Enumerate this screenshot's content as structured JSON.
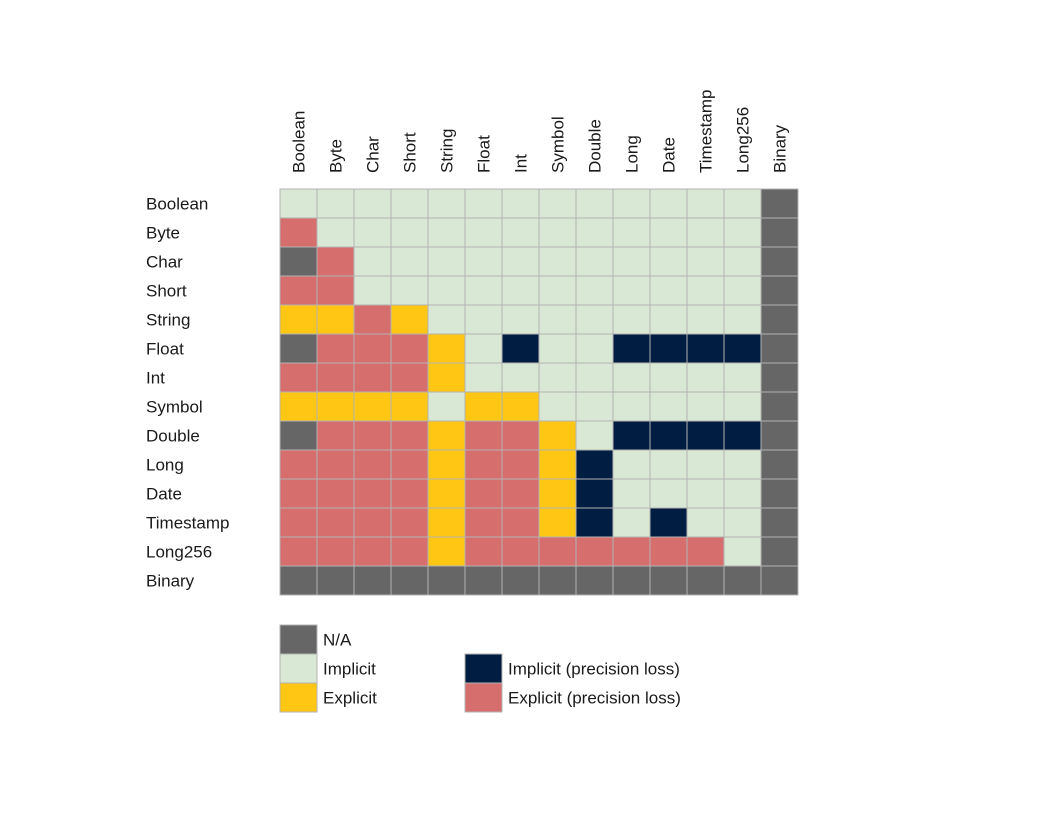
{
  "chart_data": {
    "type": "heatmap",
    "title": "",
    "xlabel": "",
    "ylabel": "",
    "grid": true,
    "columns": [
      "Boolean",
      "Byte",
      "Char",
      "Short",
      "String",
      "Float",
      "Int",
      "Symbol",
      "Double",
      "Long",
      "Date",
      "Timestamp",
      "Long256",
      "Binary"
    ],
    "rows": [
      "Boolean",
      "Byte",
      "Char",
      "Short",
      "String",
      "Float",
      "Int",
      "Symbol",
      "Double",
      "Long",
      "Date",
      "Timestamp",
      "Long256",
      "Binary"
    ],
    "categories": {
      "N": {
        "label": "N/A",
        "color": "#666666"
      },
      "I": {
        "label": "Implicit",
        "color": "#d9e8d5"
      },
      "E": {
        "label": "Explicit",
        "color": "#ffc713"
      },
      "IP": {
        "label": "Implicit (precision loss)",
        "color": "#011e42"
      },
      "EP": {
        "label": "Explicit (precision loss)",
        "color": "#d66e6e"
      }
    },
    "legend_order": [
      [
        "N",
        "I",
        "E"
      ],
      [
        "IP",
        "EP"
      ]
    ],
    "legend_position": "bottom-left",
    "matrix": [
      [
        "I",
        "I",
        "I",
        "I",
        "I",
        "I",
        "I",
        "I",
        "I",
        "I",
        "I",
        "I",
        "I",
        "N"
      ],
      [
        "EP",
        "I",
        "I",
        "I",
        "I",
        "I",
        "I",
        "I",
        "I",
        "I",
        "I",
        "I",
        "I",
        "N"
      ],
      [
        "N",
        "EP",
        "I",
        "I",
        "I",
        "I",
        "I",
        "I",
        "I",
        "I",
        "I",
        "I",
        "I",
        "N"
      ],
      [
        "EP",
        "EP",
        "I",
        "I",
        "I",
        "I",
        "I",
        "I",
        "I",
        "I",
        "I",
        "I",
        "I",
        "N"
      ],
      [
        "E",
        "E",
        "EP",
        "E",
        "I",
        "I",
        "I",
        "I",
        "I",
        "I",
        "I",
        "I",
        "I",
        "N"
      ],
      [
        "N",
        "EP",
        "EP",
        "EP",
        "E",
        "I",
        "IP",
        "I",
        "I",
        "IP",
        "IP",
        "IP",
        "IP",
        "N"
      ],
      [
        "EP",
        "EP",
        "EP",
        "EP",
        "E",
        "I",
        "I",
        "I",
        "I",
        "I",
        "I",
        "I",
        "I",
        "N"
      ],
      [
        "E",
        "E",
        "E",
        "E",
        "I",
        "E",
        "E",
        "I",
        "I",
        "I",
        "I",
        "I",
        "I",
        "N"
      ],
      [
        "N",
        "EP",
        "EP",
        "EP",
        "E",
        "EP",
        "EP",
        "E",
        "I",
        "IP",
        "IP",
        "IP",
        "IP",
        "N"
      ],
      [
        "EP",
        "EP",
        "EP",
        "EP",
        "E",
        "EP",
        "EP",
        "E",
        "IP",
        "I",
        "I",
        "I",
        "I",
        "N"
      ],
      [
        "EP",
        "EP",
        "EP",
        "EP",
        "E",
        "EP",
        "EP",
        "E",
        "IP",
        "I",
        "I",
        "I",
        "I",
        "N"
      ],
      [
        "EP",
        "EP",
        "EP",
        "EP",
        "E",
        "EP",
        "EP",
        "E",
        "IP",
        "I",
        "IP",
        "I",
        "I",
        "N"
      ],
      [
        "EP",
        "EP",
        "EP",
        "EP",
        "E",
        "EP",
        "EP",
        "EP",
        "EP",
        "EP",
        "EP",
        "EP",
        "I",
        "N"
      ],
      [
        "N",
        "N",
        "N",
        "N",
        "N",
        "N",
        "N",
        "N",
        "N",
        "N",
        "N",
        "N",
        "N",
        "N"
      ]
    ]
  }
}
